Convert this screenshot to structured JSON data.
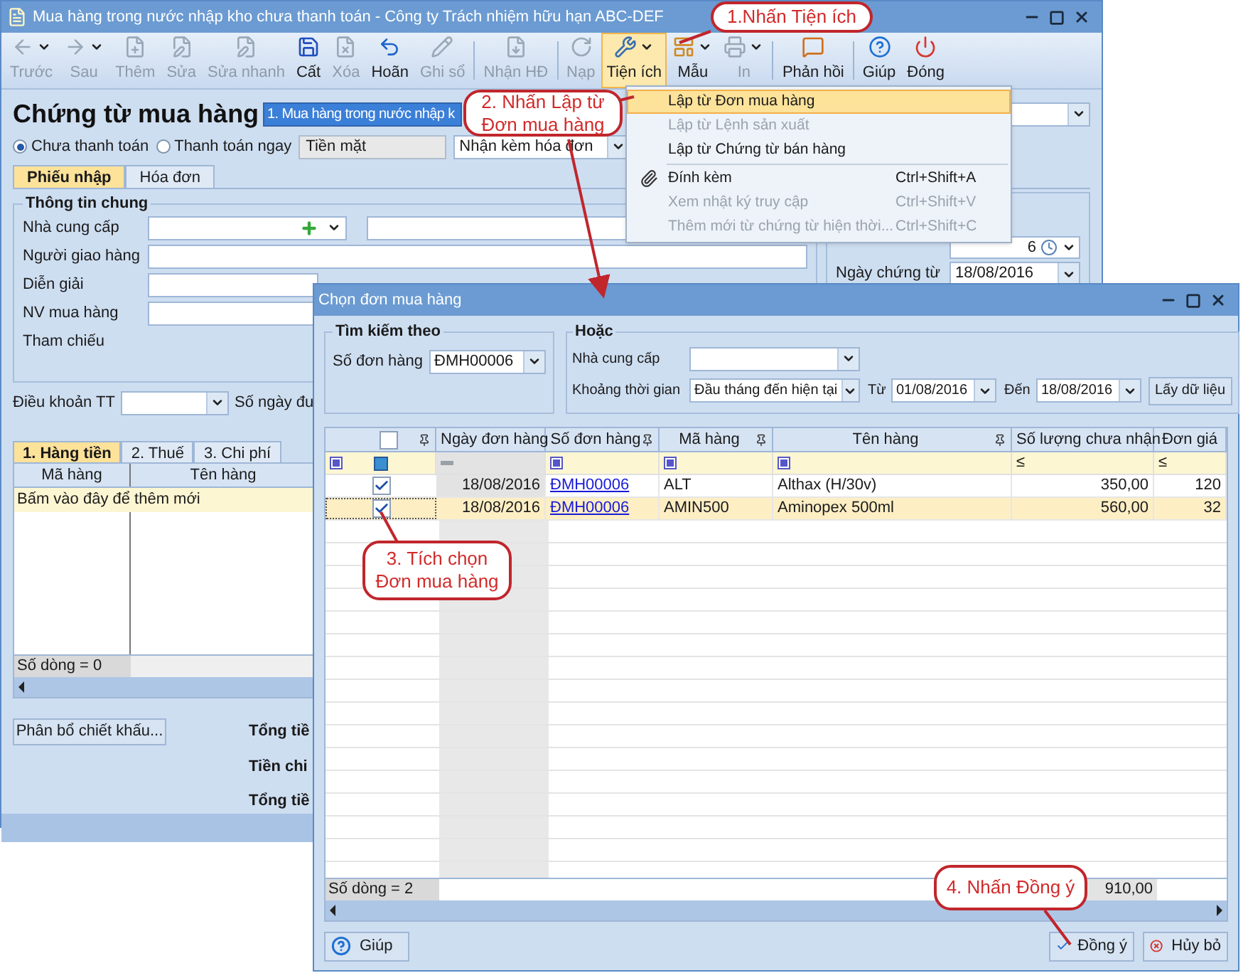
{
  "window": {
    "title": "Mua hàng trong nước nhập kho chưa thanh toán - Công ty Trách nhiệm hữu hạn ABC-DEF"
  },
  "toolbar": [
    {
      "label": "Trước",
      "kind": "split",
      "disabled": true,
      "selected": false
    },
    {
      "label": "Sau",
      "kind": "split",
      "disabled": true,
      "selected": false
    },
    {
      "label": "Thêm",
      "kind": "button",
      "disabled": true,
      "selected": false
    },
    {
      "label": "Sửa",
      "kind": "button",
      "disabled": true,
      "selected": false
    },
    {
      "label": "Sửa nhanh",
      "kind": "button",
      "disabled": true,
      "selected": false
    },
    {
      "label": "Cất",
      "kind": "button",
      "disabled": false,
      "selected": false
    },
    {
      "label": "Xóa",
      "kind": "button",
      "disabled": true,
      "selected": false
    },
    {
      "label": "Hoãn",
      "kind": "button",
      "disabled": false,
      "selected": false
    },
    {
      "label": "Ghi sổ",
      "kind": "button",
      "disabled": true,
      "selected": false
    },
    {
      "label": "Nhận HĐ",
      "kind": "button",
      "disabled": true,
      "selected": false
    },
    {
      "label": "Nạp",
      "kind": "button",
      "disabled": true,
      "selected": false
    },
    {
      "label": "Tiện ích",
      "kind": "split",
      "disabled": false,
      "selected": true
    },
    {
      "label": "Mẫu",
      "kind": "split",
      "disabled": false,
      "selected": false
    },
    {
      "label": "In",
      "kind": "split",
      "disabled": true,
      "selected": false
    },
    {
      "label": "Phản hồi",
      "kind": "button",
      "disabled": false,
      "selected": false
    },
    {
      "label": "Giúp",
      "kind": "button",
      "disabled": false,
      "selected": false
    },
    {
      "label": "Đóng",
      "kind": "button",
      "disabled": false,
      "selected": false
    }
  ],
  "header": {
    "title": "Chứng từ mua hàng",
    "type_value": "1. Mua hàng trong nước nhập k"
  },
  "payment_options": [
    {
      "label": "Chưa thanh toán",
      "selected": true
    },
    {
      "label": "Thanh toán ngay",
      "selected": false
    }
  ],
  "payment_method": "Tiền mặt",
  "invoice_option": "Nhận kèm hóa đơn",
  "tabs": [
    {
      "label": "Phiếu nhập",
      "selected": true
    },
    {
      "label": "Hóa đơn",
      "selected": false
    }
  ],
  "general": {
    "title": "Thông tin chung",
    "fields": [
      {
        "label": "Nhà cung cấp",
        "kind": "lookup"
      },
      {
        "label": "Người giao hàng",
        "kind": "wide"
      },
      {
        "label": "Diễn giải",
        "kind": "short"
      },
      {
        "label": "NV mua hàng",
        "kind": "short"
      },
      {
        "label": "Tham chiếu",
        "kind": "label"
      }
    ]
  },
  "dates": {
    "partial_value": "6",
    "label": "Ngày chứng từ",
    "value": "18/08/2016"
  },
  "terms": {
    "label": "Điều khoản TT",
    "next_label": "Số ngày đư"
  },
  "detail_tabs": [
    {
      "label": "1. Hàng tiền",
      "selected": true
    },
    {
      "label": "2. Thuế",
      "selected": false
    },
    {
      "label": "3. Chi phí",
      "selected": false
    }
  ],
  "detail_grid": {
    "columns": [
      "Mã hàng",
      "Tên hàng"
    ],
    "new_row": "Bấm vào đây để thêm mới",
    "footer": "Số dòng = 0"
  },
  "allocate_button": "Phân bổ chiết khấu...",
  "totals": [
    "Tổng tiề",
    "Tiền chi",
    "Tổng tiề"
  ],
  "menu": [
    {
      "label": "Lập từ Đơn mua hàng",
      "disabled": false,
      "selected": true
    },
    {
      "label": "Lập từ Lệnh sản xuất",
      "disabled": true,
      "selected": false
    },
    {
      "label": "Lập từ Chứng từ bán hàng",
      "disabled": false,
      "selected": false
    },
    {
      "label": "Đính kèm",
      "shortcut": "Ctrl+Shift+A",
      "disabled": false,
      "selected": false
    },
    {
      "label": "Xem nhật ký truy cập",
      "shortcut": "Ctrl+Shift+V",
      "disabled": true,
      "selected": false
    },
    {
      "label": "Thêm mới từ chứng từ hiện thời...",
      "shortcut": "Ctrl+Shift+C",
      "disabled": true,
      "selected": false
    }
  ],
  "dialog": {
    "title": "Chọn đơn mua hàng",
    "search_group": {
      "title": "Tìm kiếm theo",
      "label": "Số đơn hàng",
      "value": "ĐMH00006"
    },
    "or_group": {
      "title": "Hoặc",
      "supplier_label": "Nhà cung cấp",
      "period_label": "Khoảng thời gian",
      "period_value": "Đầu tháng đến hiện tại",
      "from_label": "Từ",
      "from_value": "01/08/2016",
      "to_label": "Đến",
      "to_value": "18/08/2016",
      "fetch_button": "Lấy dữ liệu"
    },
    "grid": {
      "all_checked": false,
      "columns": [
        {
          "label": "Ngày đơn hàng",
          "kind": "dash"
        },
        {
          "label": "Số đơn hàng",
          "kind": "box"
        },
        {
          "label": "Mã hàng",
          "kind": "box"
        },
        {
          "label": "Tên hàng",
          "kind": "box"
        },
        {
          "label": "Số lượng chưa nhận",
          "filter_text": "≤"
        },
        {
          "label": "Đơn giá",
          "filter_text": "≤"
        }
      ],
      "rows": [
        {
          "checked": true,
          "selected": false,
          "cells": [
            "18/08/2016",
            "ĐMH00006",
            "ALT",
            "Althax (H/30v)",
            "350,00",
            "120"
          ]
        },
        {
          "checked": true,
          "selected": true,
          "cells": [
            "18/08/2016",
            "ĐMH00006",
            "AMIN500",
            "Aminopex 500ml",
            "560,00",
            "32"
          ]
        }
      ],
      "footer_count": "Số dòng = 2",
      "footer_total": "910,00"
    },
    "buttons": [
      {
        "label": "Giúp",
        "kind": "help"
      },
      {
        "label": "Đồng ý",
        "kind": "ok"
      },
      {
        "label": "Hủy bỏ",
        "kind": "cancel"
      }
    ]
  },
  "callouts": [
    "1.Nhấn Tiện ích",
    "2. Nhấn Lập từ Đơn mua hàng",
    "3. Tích chọn Đơn mua hàng",
    "4. Nhấn Đồng ý"
  ]
}
